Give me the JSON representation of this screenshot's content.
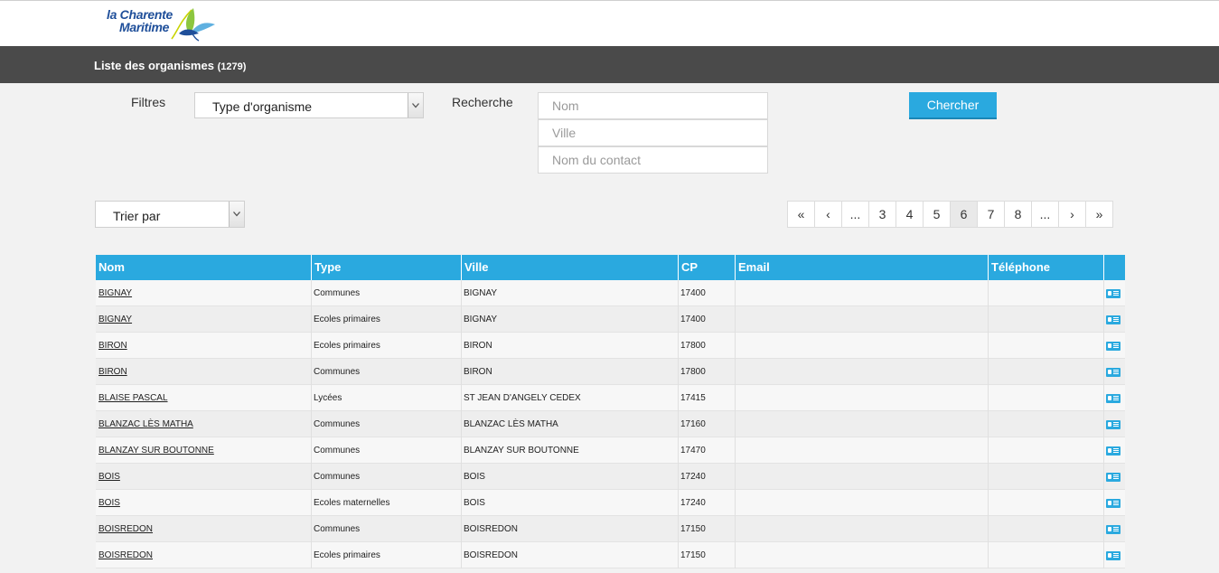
{
  "logo": {
    "line1": "la Charente",
    "line2": "Maritime"
  },
  "title": {
    "text": "Liste des organismes",
    "count": "(1279)"
  },
  "filters": {
    "label": "Filtres",
    "type_select": "Type d'organisme",
    "search_label": "Recherche",
    "placeholders": {
      "nom": "Nom",
      "ville": "Ville",
      "contact": "Nom du contact"
    },
    "search_button": "Chercher"
  },
  "sort": {
    "label": "Trier par"
  },
  "pagination": [
    "«",
    "‹",
    "...",
    "3",
    "4",
    "5",
    "6",
    "7",
    "8",
    "...",
    "›",
    "»"
  ],
  "pagination_active": "6",
  "table": {
    "headers": [
      "Nom",
      "Type",
      "Ville",
      "CP",
      "Email",
      "Téléphone"
    ],
    "rows": [
      [
        "BIGNAY",
        "Communes",
        "BIGNAY",
        "17400"
      ],
      [
        "BIGNAY",
        "Ecoles primaires",
        "BIGNAY",
        "17400"
      ],
      [
        "BIRON",
        "Ecoles primaires",
        "BIRON",
        "17800"
      ],
      [
        "BIRON",
        "Communes",
        "BIRON",
        "17800"
      ],
      [
        "BLAISE PASCAL",
        "Lycées",
        "ST JEAN D'ANGELY CEDEX",
        "17415"
      ],
      [
        "BLANZAC LÈS MATHA",
        "Communes",
        "BLANZAC LÈS MATHA",
        "17160"
      ],
      [
        "BLANZAY SUR BOUTONNE",
        "Communes",
        "BLANZAY SUR BOUTONNE",
        "17470"
      ],
      [
        "BOIS",
        "Communes",
        "BOIS",
        "17240"
      ],
      [
        "BOIS",
        "Ecoles maternelles",
        "BOIS",
        "17240"
      ],
      [
        "BOISREDON",
        "Communes",
        "BOISREDON",
        "17150"
      ],
      [
        "BOISREDON",
        "Ecoles primaires",
        "BOISREDON",
        "17150"
      ]
    ]
  },
  "colors": {
    "accent": "#2aa9df",
    "titlebar": "#4a4a4a",
    "logo_blue": "#1f4f9a",
    "logo_green": "#8cc63f"
  }
}
